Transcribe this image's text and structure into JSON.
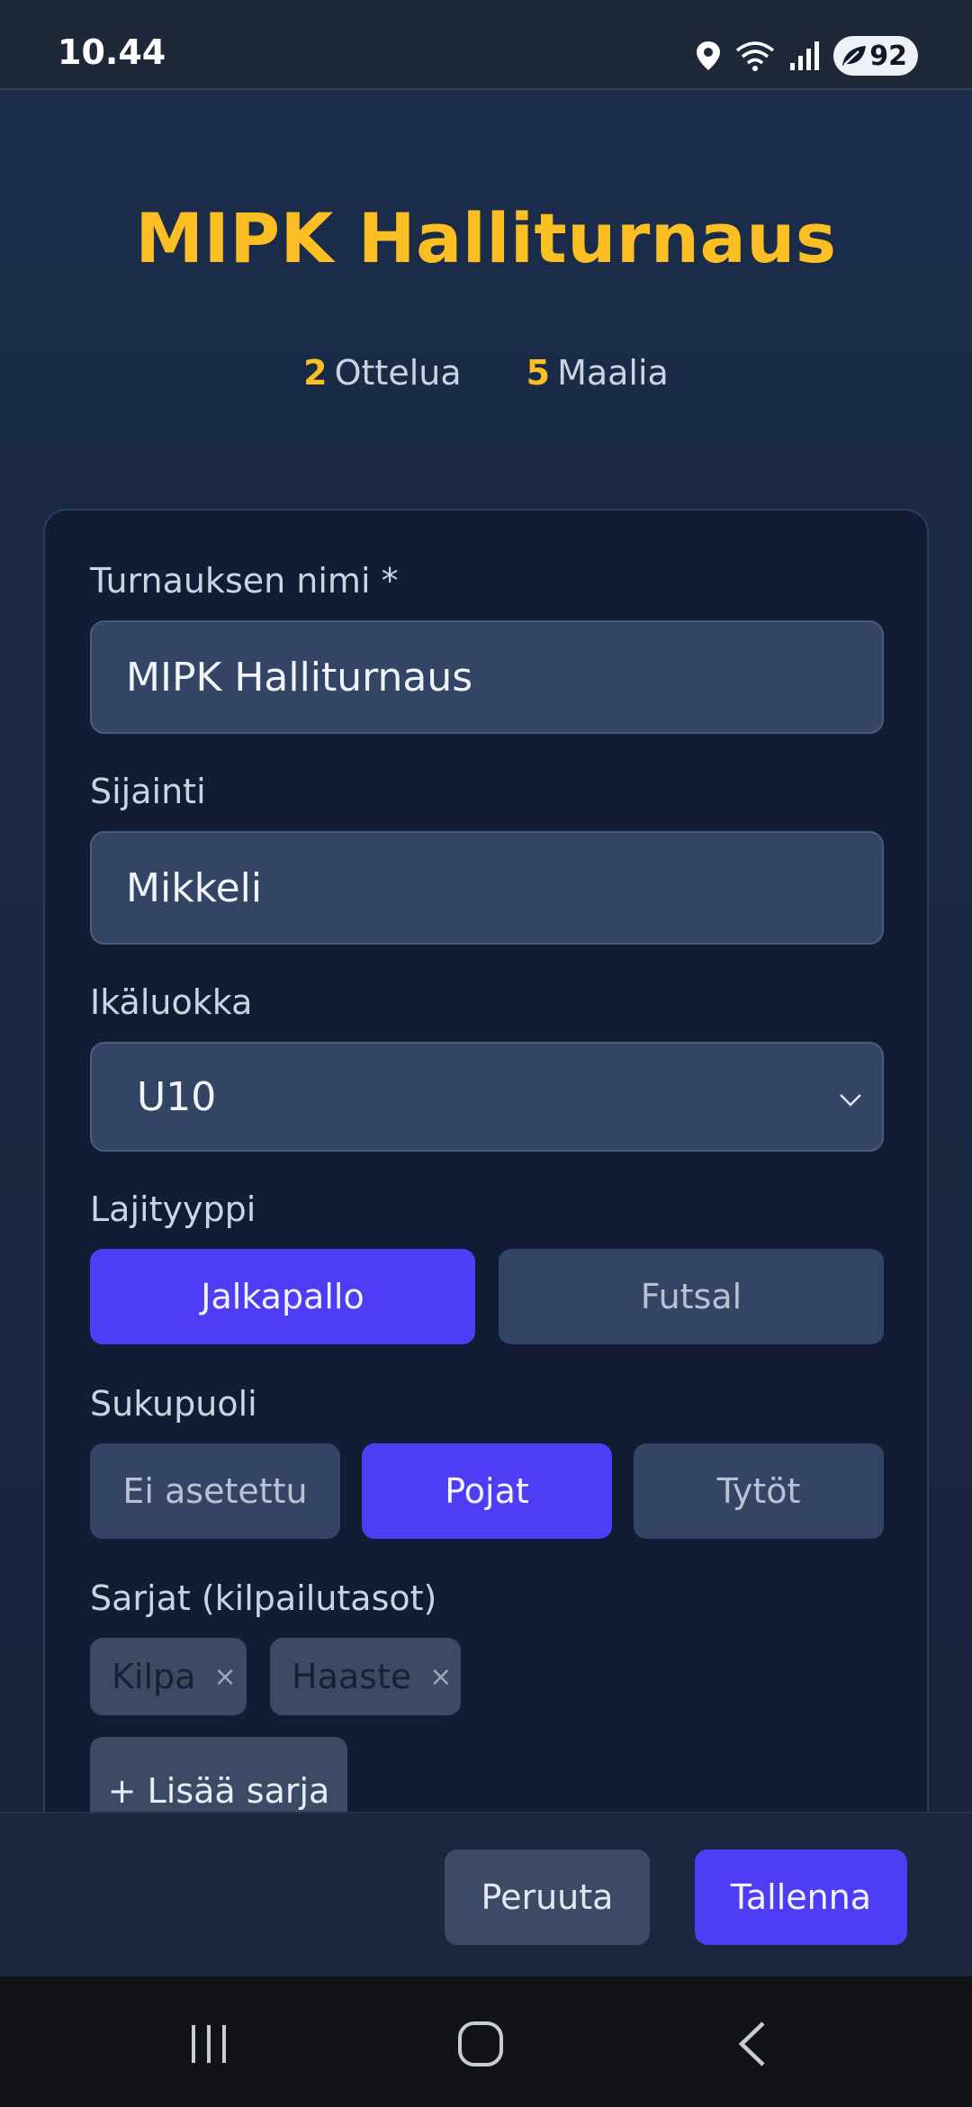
{
  "status_bar": {
    "time": "10.44",
    "battery": "92",
    "icons": [
      "location-icon",
      "wifi-icon",
      "signal-icon",
      "battery-icon"
    ]
  },
  "header": {
    "title": "MIPK Halliturnaus",
    "stats": [
      {
        "value": "2",
        "label": "Ottelua"
      },
      {
        "value": "5",
        "label": "Maalia"
      }
    ]
  },
  "form": {
    "name": {
      "label": "Turnauksen nimi *",
      "value": "MIPK Halliturnaus"
    },
    "location": {
      "label": "Sijainti",
      "value": "Mikkeli"
    },
    "age_class": {
      "label": "Ikäluokka",
      "value": "U10"
    },
    "sport_type": {
      "label": "Lajityyppi",
      "options": [
        "Jalkapallo",
        "Futsal"
      ],
      "selected": "Jalkapallo"
    },
    "gender": {
      "label": "Sukupuoli",
      "options": [
        "Ei asetettu",
        "Pojat",
        "Tytöt"
      ],
      "selected": "Pojat"
    },
    "series": {
      "label": "Sarjat (kilpailutasot)",
      "chips": [
        "Kilpa",
        "Haaste"
      ],
      "remove_glyph": "×",
      "add_label": "+ Lisää sarja"
    }
  },
  "actions": {
    "cancel": "Peruuta",
    "save": "Tallenna"
  },
  "colors": {
    "accent": "#4f3cf5",
    "title": "#fbbf24",
    "background": "#1a2a45",
    "input": "#334465"
  }
}
